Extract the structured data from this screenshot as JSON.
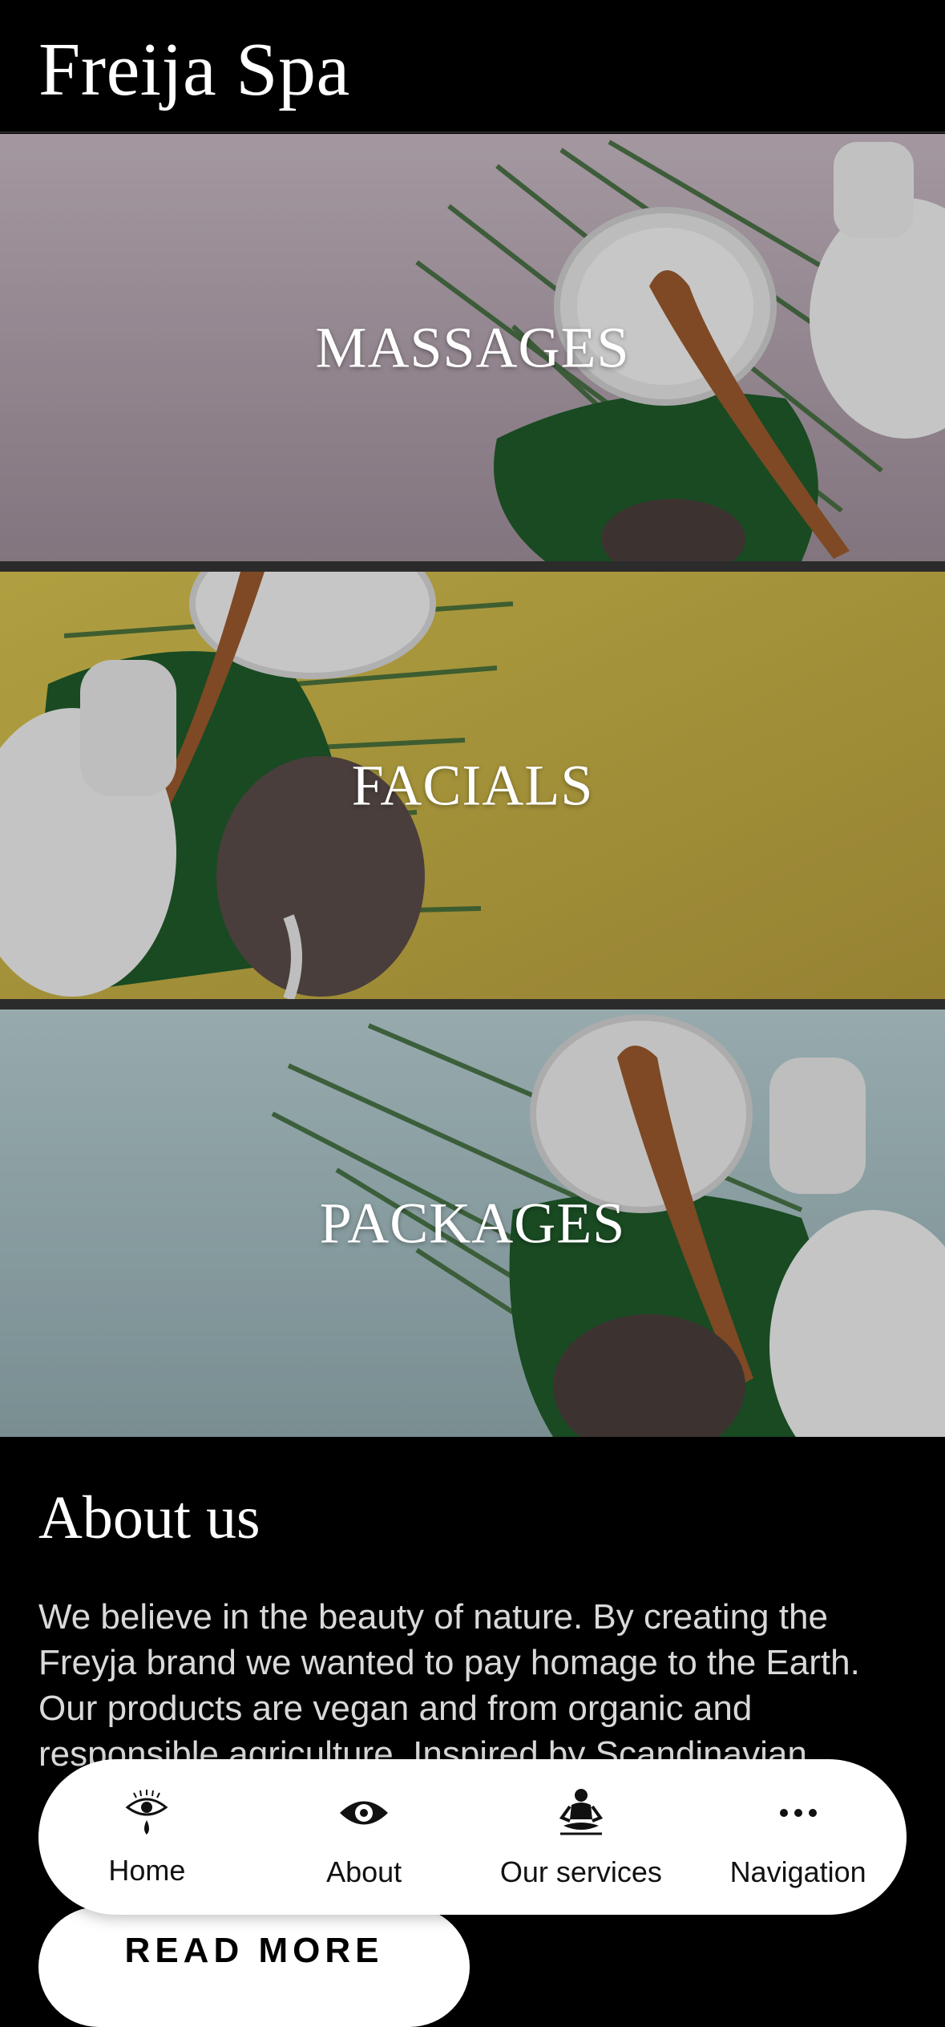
{
  "header": {
    "brand": "Freija Spa"
  },
  "categories": [
    {
      "label": "MASSAGES",
      "bg": "#b7a9b3"
    },
    {
      "label": "FACIALS",
      "bg": "#cdb94a"
    },
    {
      "label": "PACKAGES",
      "bg": "#a9c2c6"
    }
  ],
  "about": {
    "title": "About us",
    "text": "We believe in the beauty of nature. By creating the Freyja brand we wanted to pay homage to the Earth. Our products are vegan and from organic and responsible agriculture. Inspired by Scandinavian",
    "read_more_label": "READ MORE"
  },
  "bottom_nav": {
    "items": [
      {
        "label": "Home",
        "icon": "eye-tear-icon"
      },
      {
        "label": "About",
        "icon": "eye-icon"
      },
      {
        "label": "Our services",
        "icon": "meditation-icon"
      },
      {
        "label": "Navigation",
        "icon": "more-dots-icon"
      }
    ]
  },
  "colors": {
    "background": "#000000",
    "text_light": "#ffffff",
    "text_muted": "#d9d9d9",
    "nav_bg": "#ffffff"
  }
}
